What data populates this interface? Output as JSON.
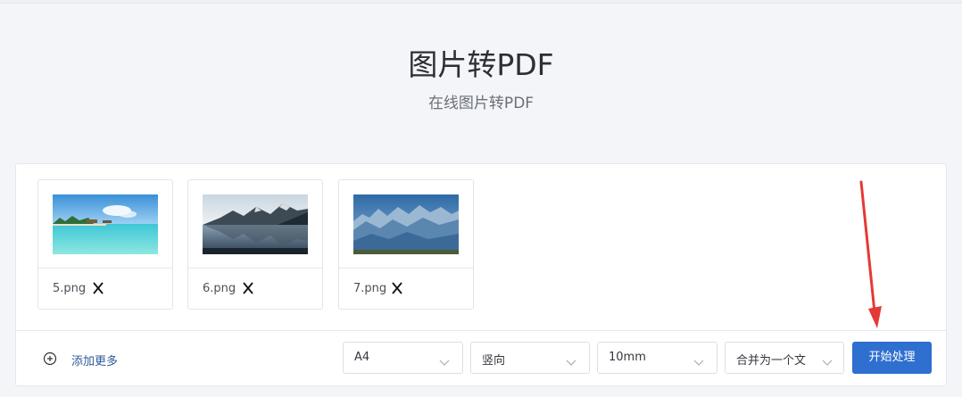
{
  "header": {
    "title": "图片转PDF",
    "subtitle": "在线图片转PDF"
  },
  "files": [
    {
      "name": "5.png",
      "thumbnail": "tropical-beach-photo",
      "close_icon": "close-icon"
    },
    {
      "name": "6.png",
      "thumbnail": "mountain-lake-photo",
      "close_icon": "close-icon"
    },
    {
      "name": "7.png",
      "thumbnail": "blue-mountains-photo",
      "close_icon": "close-icon"
    }
  ],
  "toolbar": {
    "add_more_label": "添加更多",
    "add_more_icon": "plus-circle-icon",
    "page_size": "A4",
    "orientation": "竖向",
    "margin": "10mm",
    "merge_mode": "合并为一个文",
    "start_label": "开始处理"
  },
  "colors": {
    "accent": "#2f6fd0",
    "annotation_arrow": "#e53935",
    "link": "#2d5a9a"
  }
}
